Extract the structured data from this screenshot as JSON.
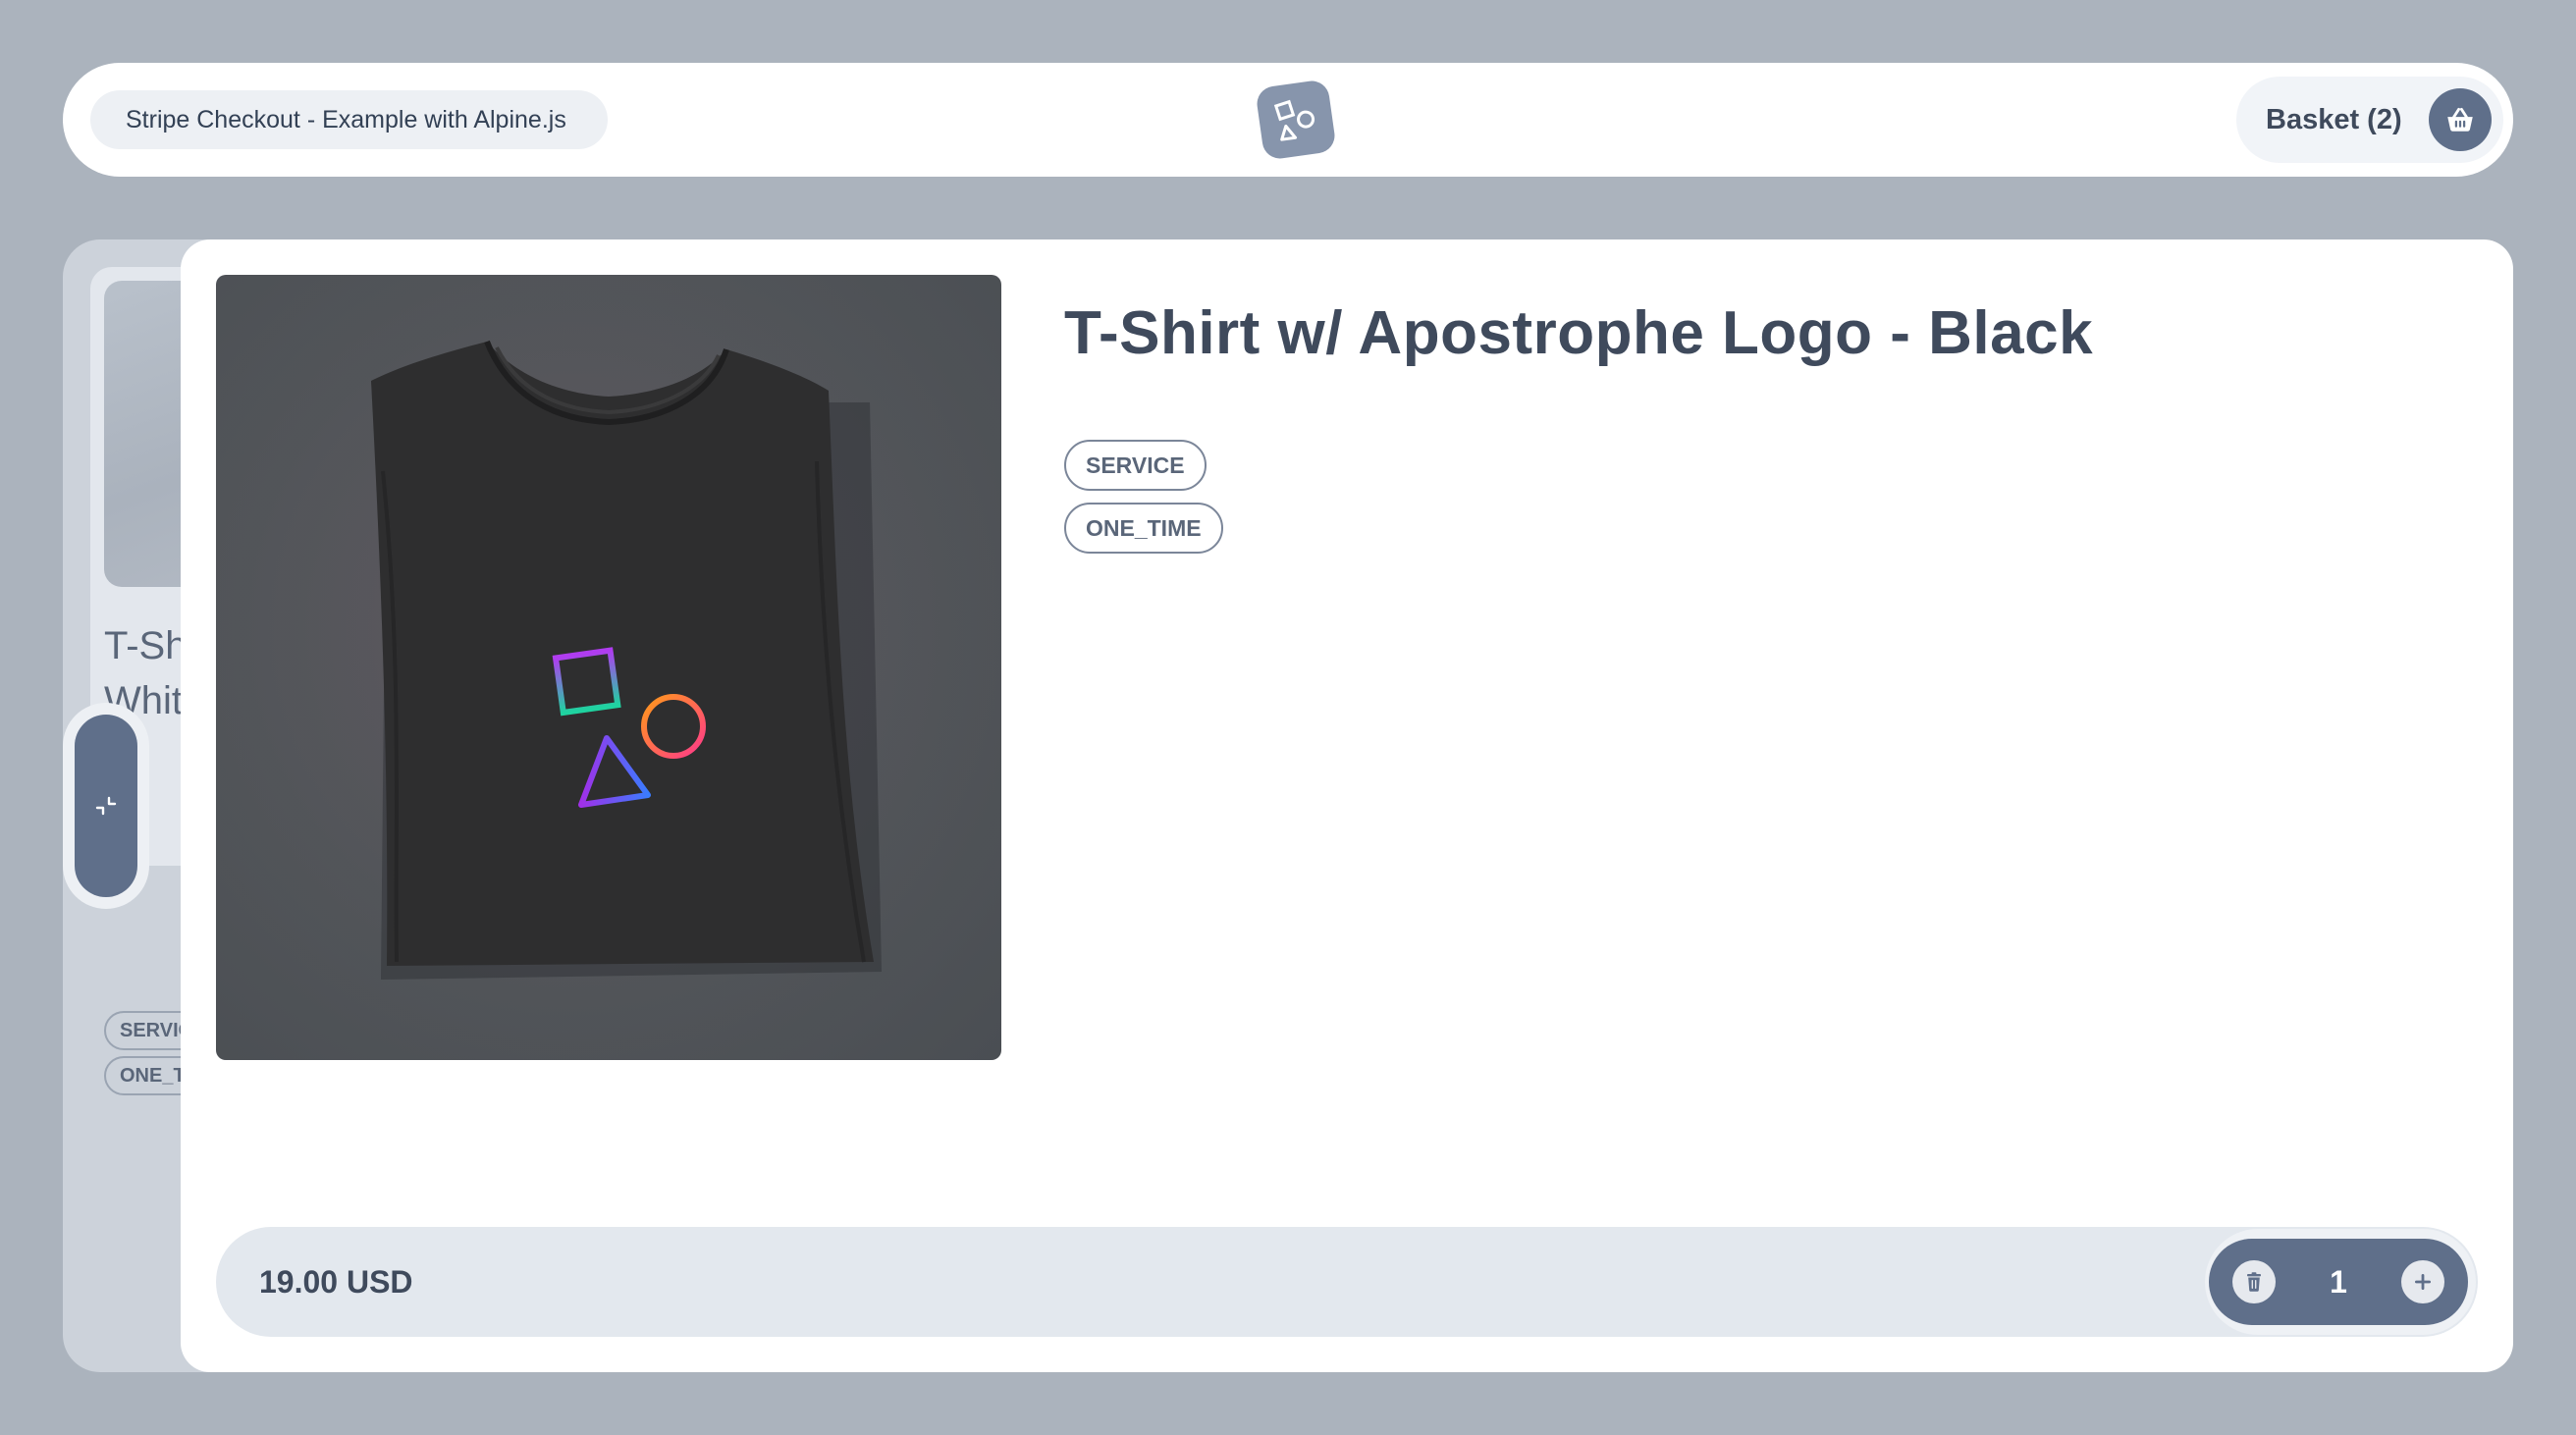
{
  "header": {
    "app_title": "Stripe Checkout - Example with Alpine.js",
    "logo_icon": "shapes-logo-icon",
    "basket_label": "Basket (2)",
    "basket_icon": "basket-icon"
  },
  "previous_product": {
    "title": "T-Shirt w/ Apostrophe Logo -\nWhite",
    "tags": [
      "SERVICE",
      "ONE_TIME"
    ]
  },
  "collapse_toggle": {
    "icon": "collapse-arrows-icon"
  },
  "product": {
    "title": "T-Shirt w/ Apostrophe Logo - Black",
    "tags": [
      "SERVICE",
      "ONE_TIME"
    ],
    "price": "19.00 USD",
    "quantity": "1"
  },
  "colors": {
    "page_background": "#abb3bd",
    "accent": "#5f6f8a",
    "text": "#3f4a5c",
    "shirt": "#2f2f30"
  }
}
